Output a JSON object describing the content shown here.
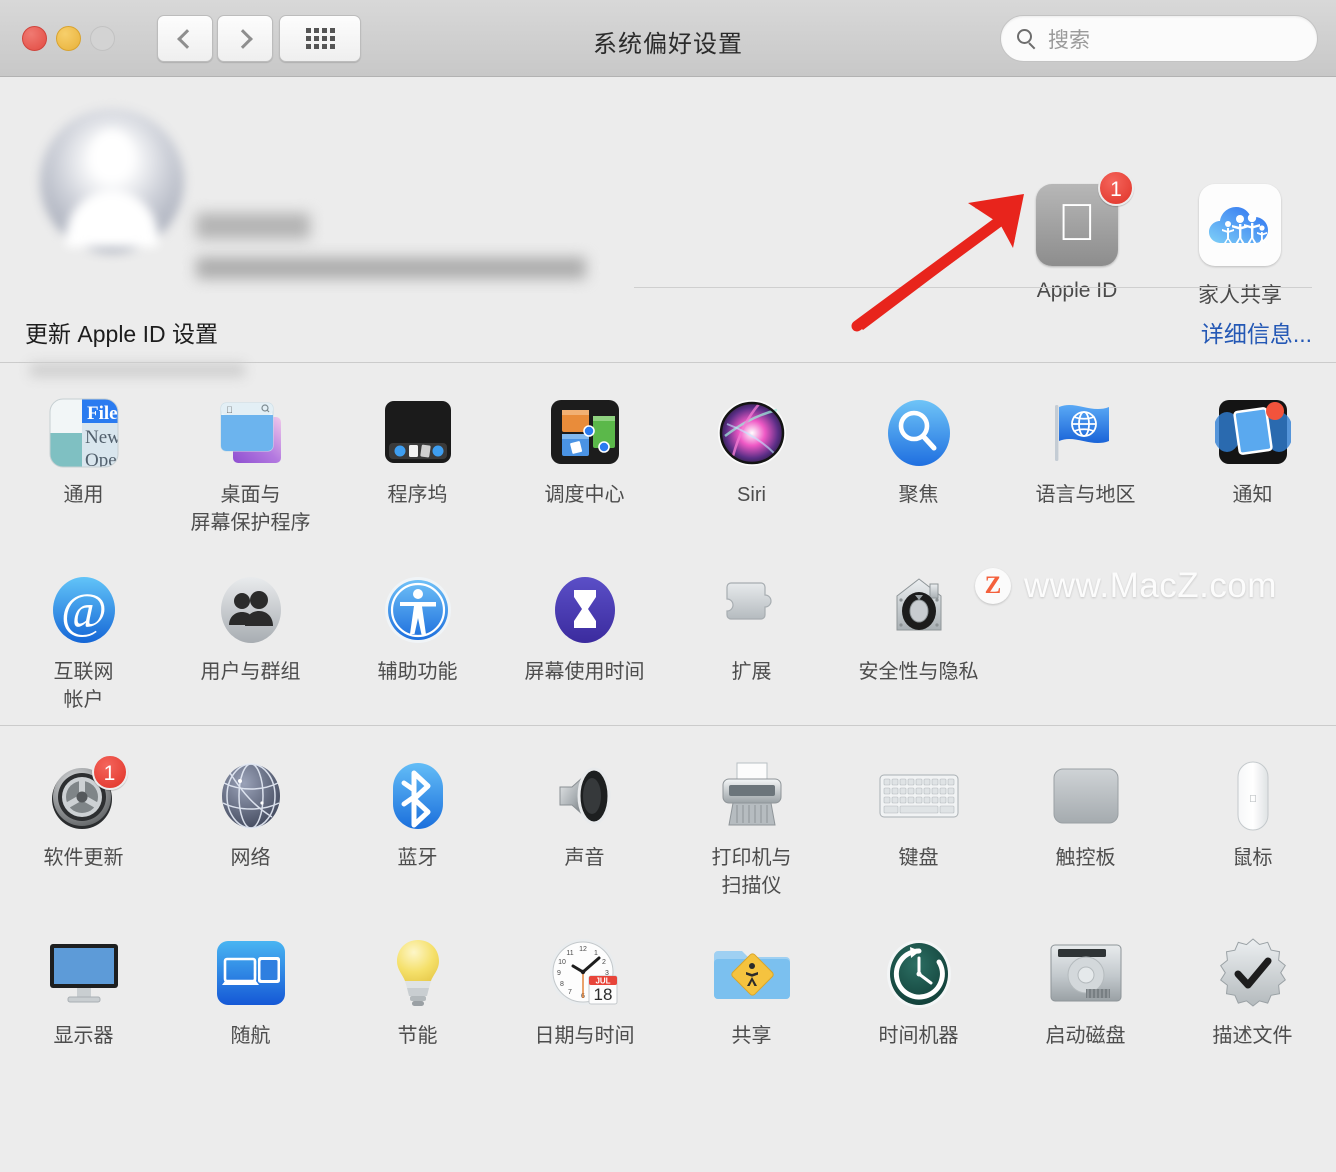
{
  "window": {
    "title": "系统偏好设置",
    "traffic_lights": [
      "close",
      "minimize",
      "zoom"
    ]
  },
  "toolbar": {
    "back_label": "‹",
    "forward_label": "›",
    "showall_label": "show-all-grid",
    "search_placeholder": "搜索",
    "search_value": ""
  },
  "appleid_section": {
    "user_name": "",
    "user_detail": "",
    "update_text": "更新 Apple ID 设置",
    "details_link": "详细信息...",
    "tiles": [
      {
        "label": "Apple ID",
        "icon": "apple-logo-icon",
        "badge": "1"
      },
      {
        "label": "家人共享",
        "icon": "family-sharing-icon",
        "badge": ""
      }
    ]
  },
  "groups": [
    {
      "rows": [
        [
          {
            "label": "通用",
            "icon": "general-icon",
            "badge": ""
          },
          {
            "label": "桌面与\n屏幕保护程序",
            "icon": "desktop-screensaver-icon",
            "badge": ""
          },
          {
            "label": "程序坞",
            "icon": "dock-icon",
            "badge": ""
          },
          {
            "label": "调度中心",
            "icon": "mission-control-icon",
            "badge": ""
          },
          {
            "label": "Siri",
            "icon": "siri-icon",
            "badge": ""
          },
          {
            "label": "聚焦",
            "icon": "spotlight-icon",
            "badge": ""
          },
          {
            "label": "语言与地区",
            "icon": "language-region-icon",
            "badge": ""
          },
          {
            "label": "通知",
            "icon": "notifications-icon",
            "badge": ""
          }
        ],
        [
          {
            "label": "互联网\n帐户",
            "icon": "internet-accounts-icon",
            "badge": ""
          },
          {
            "label": "用户与群组",
            "icon": "users-groups-icon",
            "badge": ""
          },
          {
            "label": "辅助功能",
            "icon": "accessibility-icon",
            "badge": ""
          },
          {
            "label": "屏幕使用时间",
            "icon": "screen-time-icon",
            "badge": ""
          },
          {
            "label": "扩展",
            "icon": "extensions-icon",
            "badge": ""
          },
          {
            "label": "安全性与隐私",
            "icon": "security-privacy-icon",
            "badge": ""
          },
          {
            "label": "",
            "icon": "",
            "badge": ""
          },
          {
            "label": "",
            "icon": "",
            "badge": ""
          }
        ]
      ]
    },
    {
      "rows": [
        [
          {
            "label": "软件更新",
            "icon": "software-update-icon",
            "badge": "1"
          },
          {
            "label": "网络",
            "icon": "network-icon",
            "badge": ""
          },
          {
            "label": "蓝牙",
            "icon": "bluetooth-icon",
            "badge": ""
          },
          {
            "label": "声音",
            "icon": "sound-icon",
            "badge": ""
          },
          {
            "label": "打印机与\n扫描仪",
            "icon": "printers-scanners-icon",
            "badge": ""
          },
          {
            "label": "键盘",
            "icon": "keyboard-icon",
            "badge": ""
          },
          {
            "label": "触控板",
            "icon": "trackpad-icon",
            "badge": ""
          },
          {
            "label": "鼠标",
            "icon": "mouse-icon",
            "badge": ""
          }
        ],
        [
          {
            "label": "显示器",
            "icon": "displays-icon",
            "badge": ""
          },
          {
            "label": "随航",
            "icon": "sidecar-icon",
            "badge": ""
          },
          {
            "label": "节能",
            "icon": "energy-saver-icon",
            "badge": ""
          },
          {
            "label": "日期与时间",
            "icon": "date-time-icon",
            "badge": "",
            "calendar_month": "JUL",
            "calendar_day": "18"
          },
          {
            "label": "共享",
            "icon": "sharing-icon",
            "badge": ""
          },
          {
            "label": "时间机器",
            "icon": "time-machine-icon",
            "badge": ""
          },
          {
            "label": "启动磁盘",
            "icon": "startup-disk-icon",
            "badge": ""
          },
          {
            "label": "描述文件",
            "icon": "profiles-icon",
            "badge": ""
          }
        ]
      ]
    }
  ],
  "annotation": {
    "arrow_color": "#e8241c",
    "arrow_target": "Apple ID"
  },
  "watermark": {
    "badge": "Z",
    "text": "www.MacZ.com"
  }
}
